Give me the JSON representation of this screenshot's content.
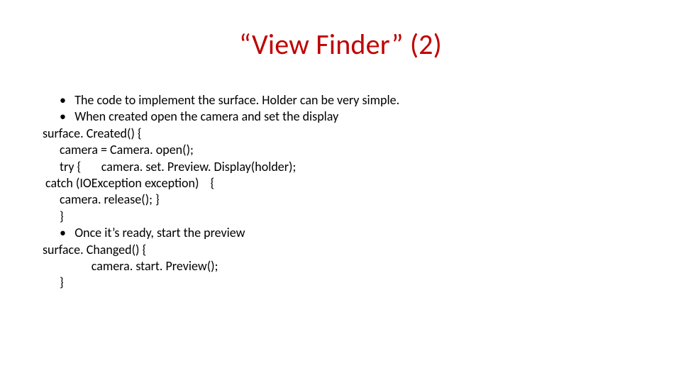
{
  "title": "“View Finder” (2)",
  "lines": {
    "l0": "The code to implement the surface. Holder can be very simple.",
    "l1": "When created open the camera and set the display",
    "l2": "surface. Created() {",
    "l3": "camera = Camera. open();",
    "l4": "try {       camera. set. Preview. Display(holder);",
    "l5": "catch (IOException exception)    {",
    "l6": "camera. release(); }",
    "l7": "}",
    "l8": "Once it’s ready, start the preview",
    "l9": "surface. Changed() {",
    "l10": "           camera. start. Preview();",
    "l11": "}"
  }
}
